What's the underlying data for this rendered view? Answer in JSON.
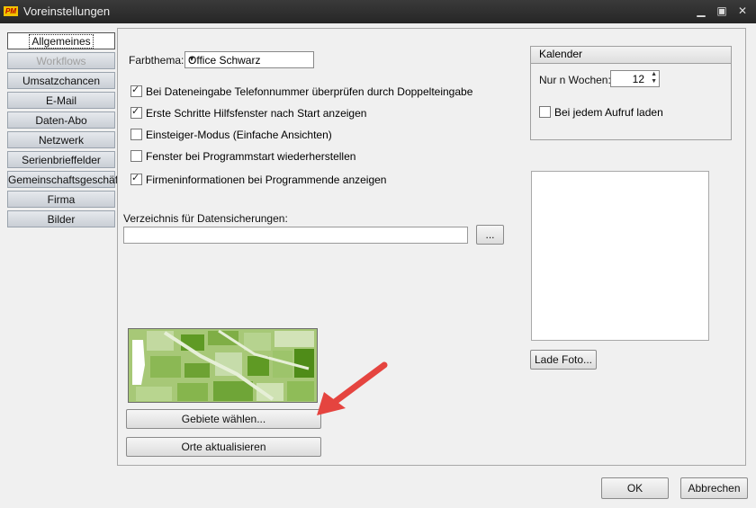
{
  "window": {
    "title": "Voreinstellungen",
    "icon_text": "PM"
  },
  "tabs": [
    {
      "label": "Allgemeines",
      "state": "active"
    },
    {
      "label": "Workflows",
      "state": "disabled"
    },
    {
      "label": "Umsatzchancen",
      "state": "normal"
    },
    {
      "label": "E-Mail",
      "state": "normal"
    },
    {
      "label": "Daten-Abo",
      "state": "normal"
    },
    {
      "label": "Netzwerk",
      "state": "normal"
    },
    {
      "label": "Serienbrieffelder",
      "state": "normal"
    },
    {
      "label": "Gemeinschaftsgeschäft",
      "state": "normal"
    },
    {
      "label": "Firma",
      "state": "normal"
    },
    {
      "label": "Bilder",
      "state": "normal"
    }
  ],
  "general": {
    "color_theme_label": "Farbthema:",
    "color_theme_value": "Office Schwarz",
    "checkboxes": [
      {
        "label": "Bei Dateneingabe Telefonnummer überprüfen durch Doppelteingabe",
        "checked": true
      },
      {
        "label": "Erste Schritte Hilfsfenster nach Start anzeigen",
        "checked": true
      },
      {
        "label": "Einsteiger-Modus (Einfache Ansichten)",
        "checked": false
      },
      {
        "label": "Fenster bei Programmstart wiederherstellen",
        "checked": false
      },
      {
        "label": "Firmeninformationen bei Programmende anzeigen",
        "checked": true
      }
    ],
    "backup_dir_label": "Verzeichnis für Datensicherungen:",
    "backup_dir_value": "",
    "browse_label": "...",
    "select_areas_label": "Gebiete wählen...",
    "update_places_label": "Orte aktualisieren"
  },
  "calendar": {
    "title": "Kalender",
    "weeks_label": "Nur n Wochen:",
    "weeks_value": "12",
    "reload_label": "Bei jedem Aufruf laden",
    "reload_checked": false
  },
  "photo": {
    "load_label": "Lade Foto..."
  },
  "footer": {
    "ok_label": "OK",
    "cancel_label": "Abbrechen"
  },
  "colors": {
    "annotation_arrow": "#e5443f",
    "map_green": "#9cc26a"
  }
}
